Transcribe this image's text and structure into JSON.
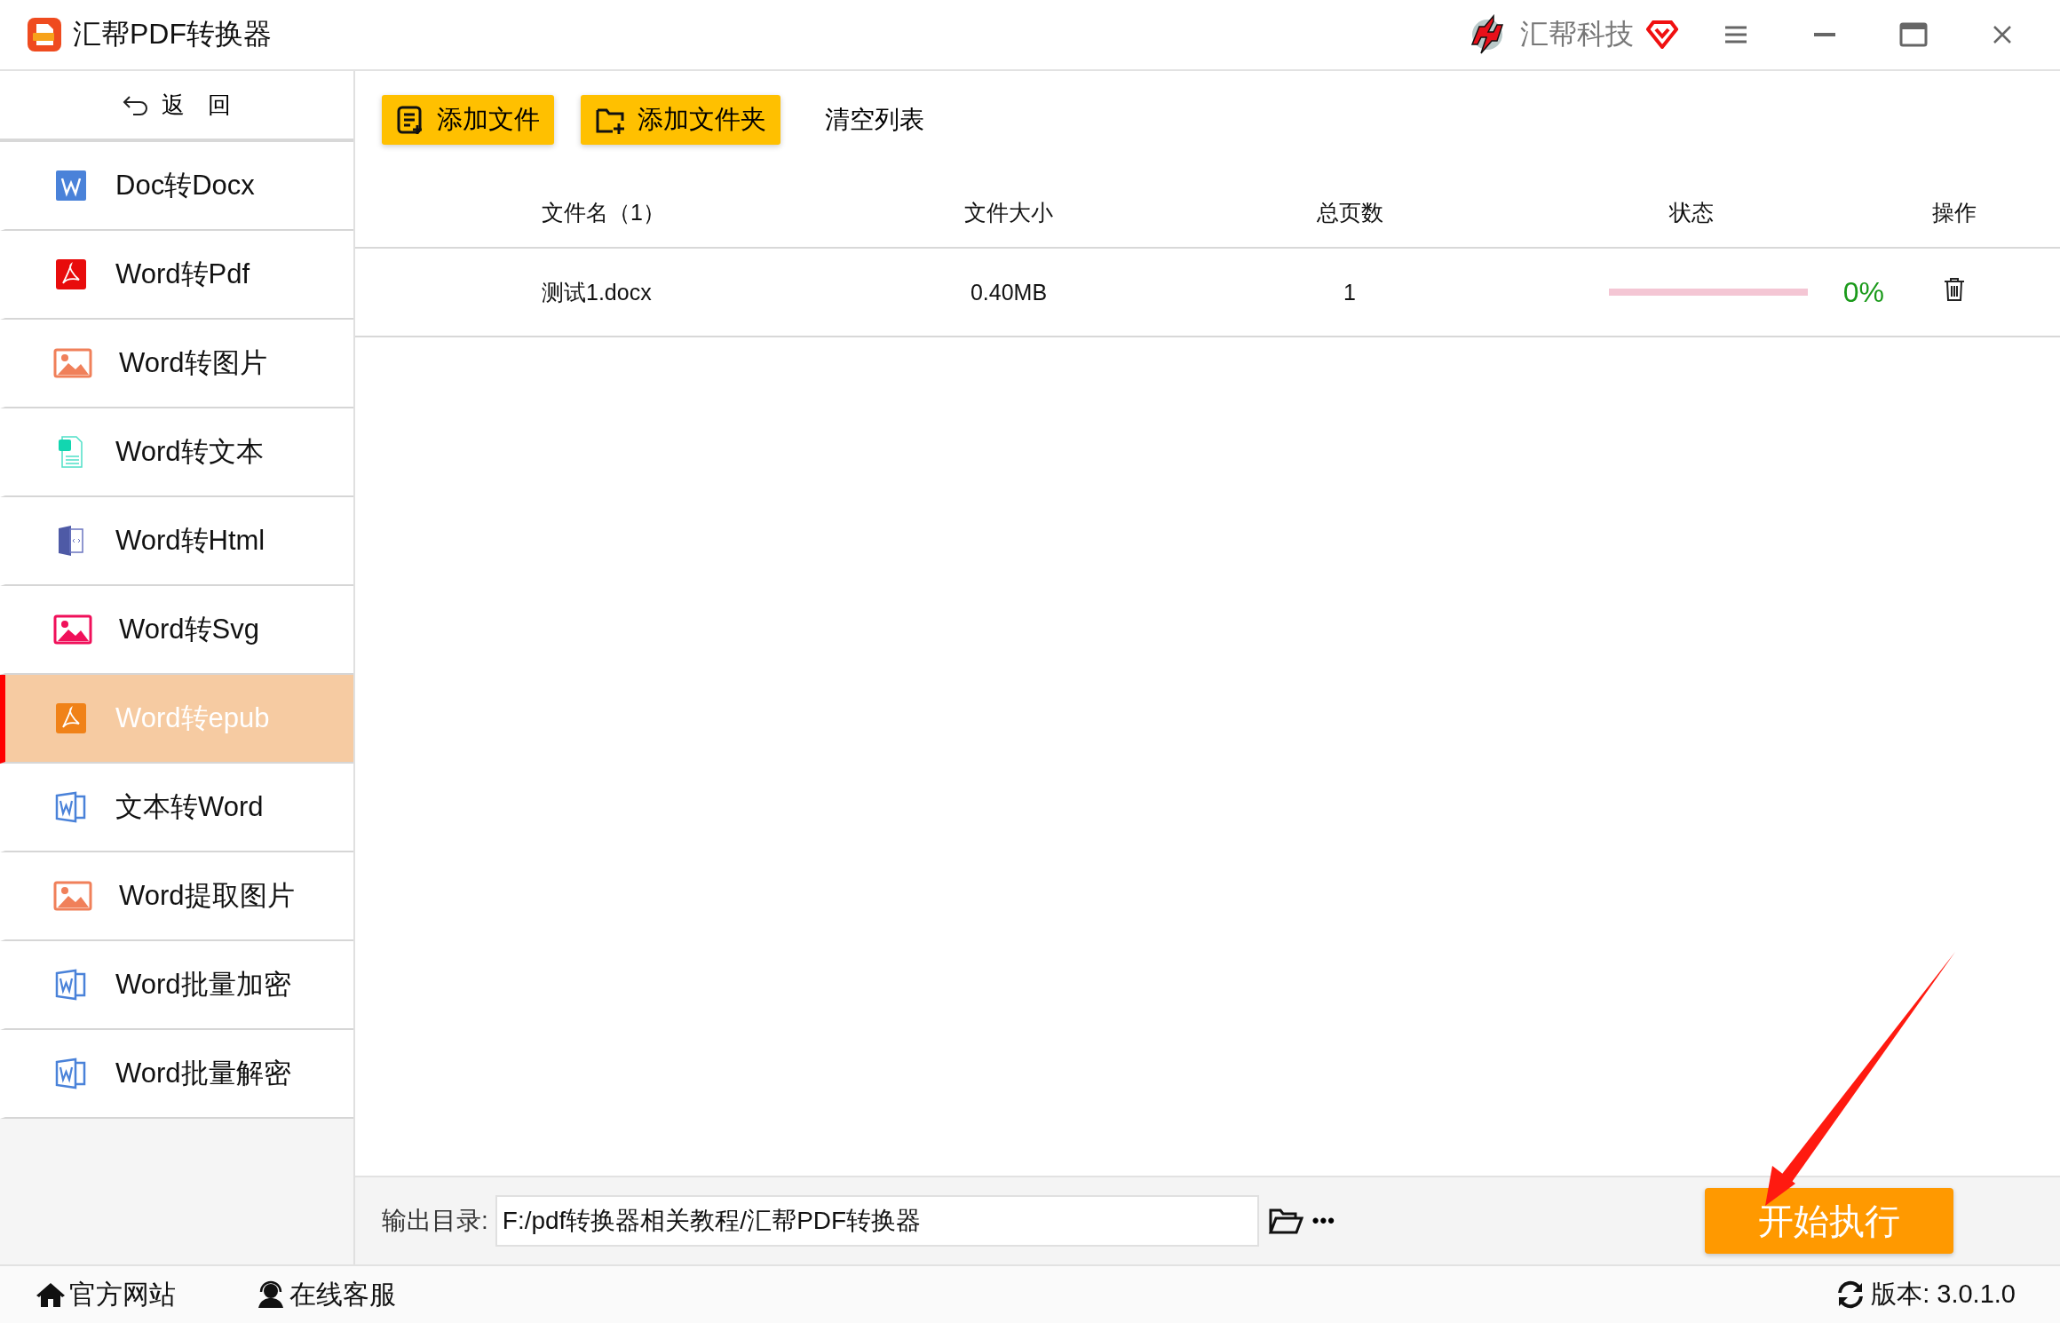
{
  "window": {
    "title": "汇帮PDF转换器",
    "brand": "汇帮科技"
  },
  "sidebar": {
    "back": "返　回",
    "items": [
      {
        "label": "Doc转Docx",
        "kind": "word",
        "selected": false
      },
      {
        "label": "Word转Pdf",
        "kind": "pdf",
        "selected": false
      },
      {
        "label": "Word转图片",
        "kind": "image",
        "selected": false
      },
      {
        "label": "Word转文本",
        "kind": "text",
        "selected": false
      },
      {
        "label": "Word转Html",
        "kind": "html",
        "selected": false
      },
      {
        "label": "Word转Svg",
        "kind": "vector",
        "selected": false
      },
      {
        "label": "Word转epub",
        "kind": "pdf",
        "selected": true
      },
      {
        "label": "文本转Word",
        "kind": "document",
        "selected": false
      },
      {
        "label": "Word提取图片",
        "kind": "image",
        "selected": false
      },
      {
        "label": "Word批量加密",
        "kind": "document",
        "selected": false
      },
      {
        "label": "Word批量解密",
        "kind": "document",
        "selected": false
      }
    ]
  },
  "toolbar": {
    "add_file": "添加文件",
    "add_folder": "添加文件夹",
    "clear": "清空列表"
  },
  "table": {
    "columns": [
      "文件名（1）",
      "文件大小",
      "总页数",
      "状态",
      "操作"
    ],
    "rows": [
      {
        "name": "测试1.docx",
        "size": "0.40MB",
        "pages": "1",
        "level": 0,
        "progress": "0%"
      }
    ]
  },
  "output": {
    "label": "输出目录:",
    "path": "F:/pdf转换器相关教程/汇帮PDF转换器",
    "more": "•••",
    "start": "开始执行"
  },
  "footer": {
    "website": "官方网站",
    "service": "在线客服",
    "version": "版本:  3.0.1.0"
  }
}
